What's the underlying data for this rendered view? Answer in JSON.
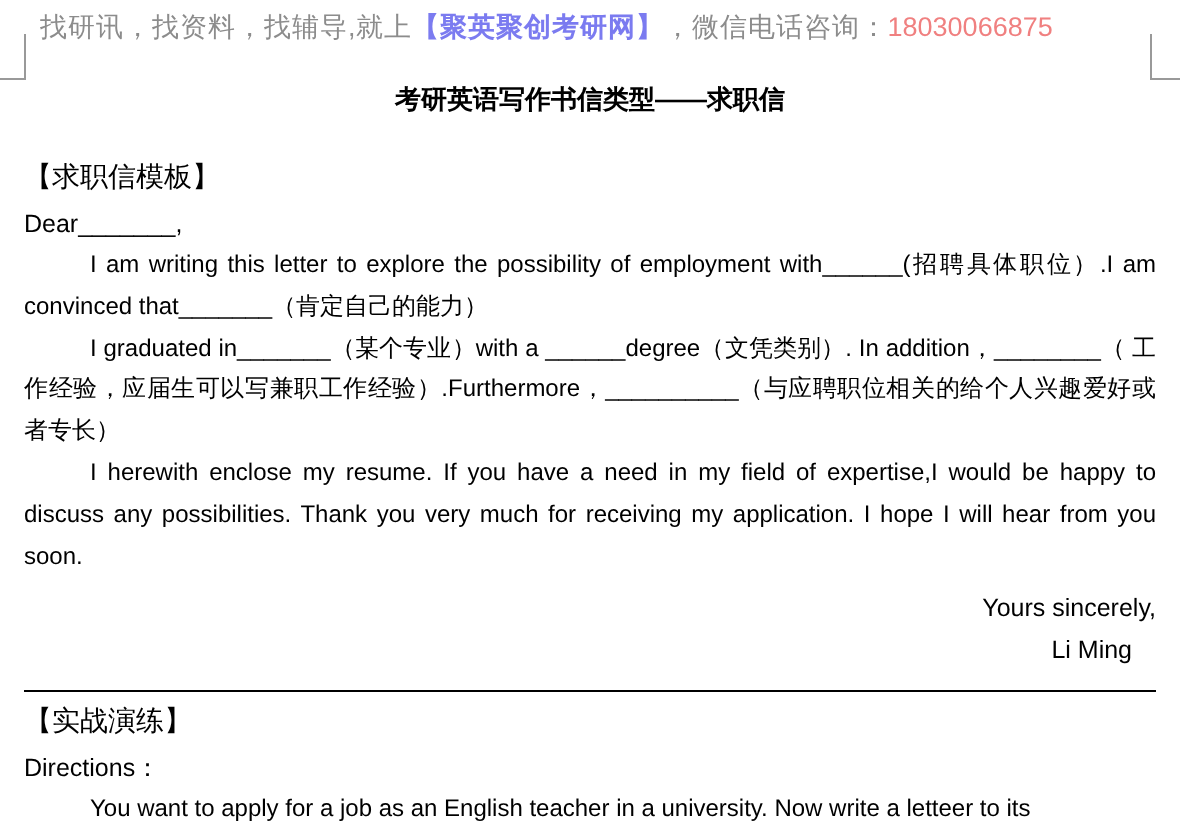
{
  "header": {
    "lead": "找研讯，找资料，找辅导,就上",
    "site": "【聚英聚创考研网】",
    "middle": "，微信电话咨询：",
    "phone": "18030066875"
  },
  "title": "考研英语写作书信类型——求职信",
  "sections": [
    {
      "heading": "【求职信模板】",
      "blocks": [
        {
          "kind": "line",
          "text": "Dear_______,"
        },
        {
          "kind": "para",
          "text": "I am writing this letter to explore the possibility of employment with______(招聘具体职位）.I am convinced that_______（肯定自己的能力）"
        },
        {
          "kind": "para",
          "text": "I graduated in_______（某个专业）with a ______degree（文凭类别）. In addition，________（ 工作经验，应届生可以写兼职工作经验）.Furthermore，__________（与应聘职位相关的给个人兴趣爱好或者专长）"
        },
        {
          "kind": "para",
          "text": "I herewith enclose my resume. If you have a need in my field of expertise,I would be happy to discuss any possibilities. Thank you very much for receiving my application. I hope I will hear from you soon."
        },
        {
          "kind": "closing",
          "text": "Yours sincerely,"
        },
        {
          "kind": "signature",
          "text": "Li Ming"
        }
      ]
    },
    {
      "heading": "【实战演练】",
      "blocks": [
        {
          "kind": "line",
          "text": "Directions："
        },
        {
          "kind": "para",
          "text": "You want to apply for a job as an English teacher in a university. Now write a letteer to its"
        }
      ]
    }
  ]
}
